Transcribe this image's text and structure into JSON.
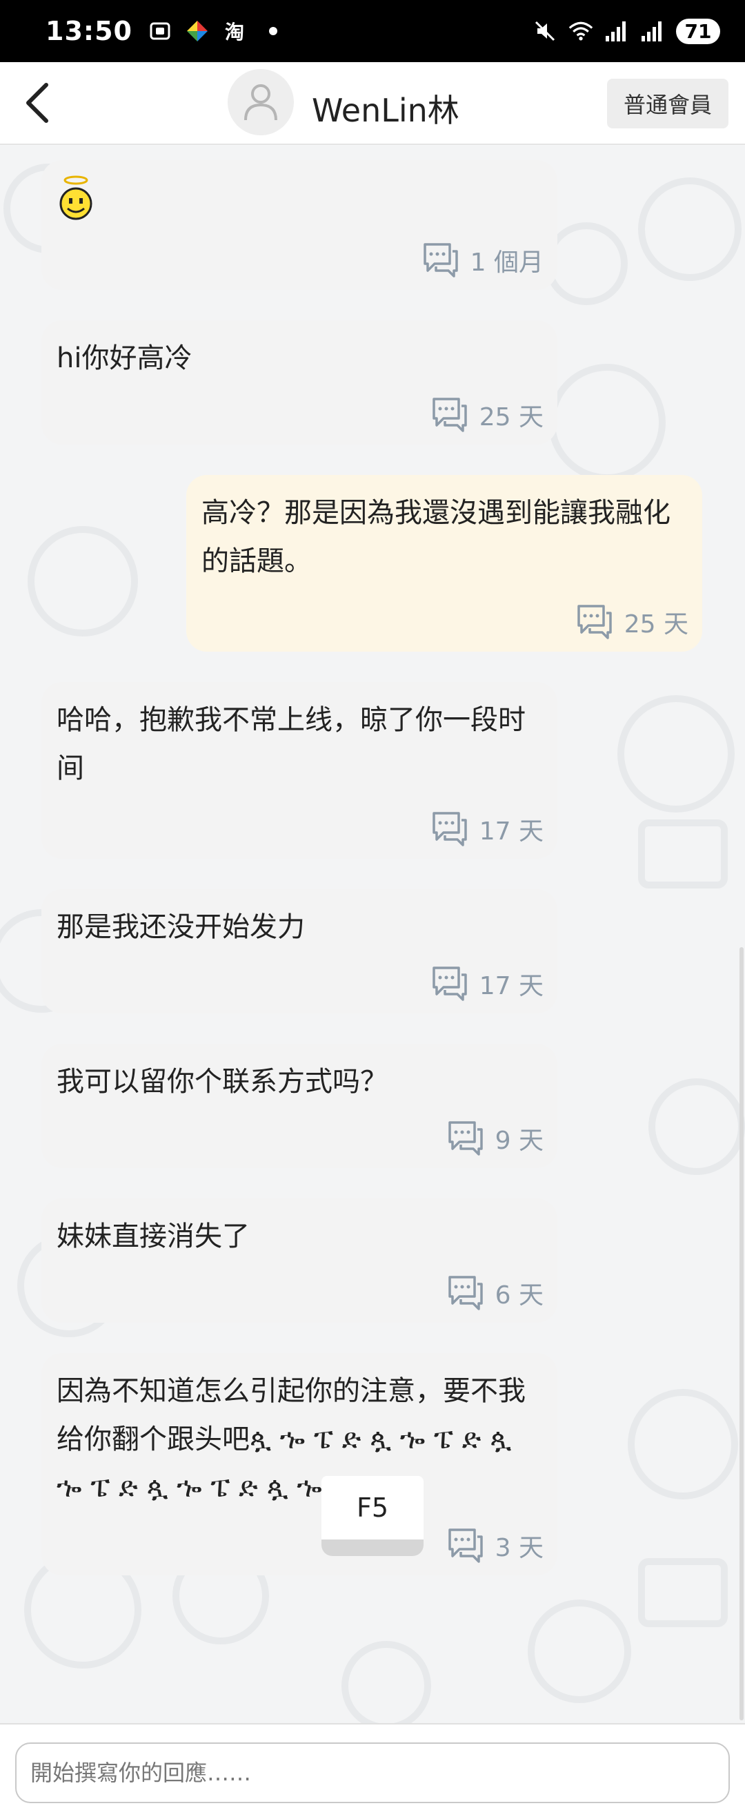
{
  "status_bar": {
    "time": "13:50",
    "taobao_glyph": "淘",
    "battery": "71",
    "icons": [
      "screenshot-icon",
      "colorful-app-icon",
      "taobao-icon",
      "mute-icon",
      "wifi-icon",
      "signal-icon",
      "signal-hd-icon",
      "battery-icon"
    ]
  },
  "header": {
    "username": "WenLin林",
    "member_badge": "普通會員"
  },
  "messages": [
    {
      "sender": "them",
      "emoji": "angel-smiley",
      "time": "1 個月"
    },
    {
      "sender": "them",
      "text": "hi你好高冷",
      "time": "25 天"
    },
    {
      "sender": "me",
      "text": "高冷？那是因為我還沒遇到能讓我融化的話題。",
      "time": "25 天"
    },
    {
      "sender": "them",
      "text": "哈哈，抱歉我不常上线，晾了你一段时间",
      "time": "17 天"
    },
    {
      "sender": "them",
      "text": "那是我还没开始发力",
      "time": "17 天"
    },
    {
      "sender": "them",
      "text": "我可以留你个联系方式吗？",
      "time": "9 天"
    },
    {
      "sender": "them",
      "text": "妹妹直接消失了",
      "time": "6 天"
    },
    {
      "sender": "them",
      "text": "因為不知道怎么引起你的注意，要不我给你翻个跟头吧ጷ ኈ ፔ ድ ጷ ኈ ፔ ድ ጷ ኈ ፔ ድ ጷ ኈ ፔ ድ ጷ ኈ ፔ ድ",
      "time": "3 天"
    }
  ],
  "f5_button": "F5",
  "reply": {
    "placeholder": "開始撰寫你的回應……"
  },
  "colors": {
    "status_bar_bg": "#000000",
    "their_bubble": "#f3f3f3",
    "my_bubble": "#fdf6e5",
    "meta_text": "#8c9aa8"
  }
}
